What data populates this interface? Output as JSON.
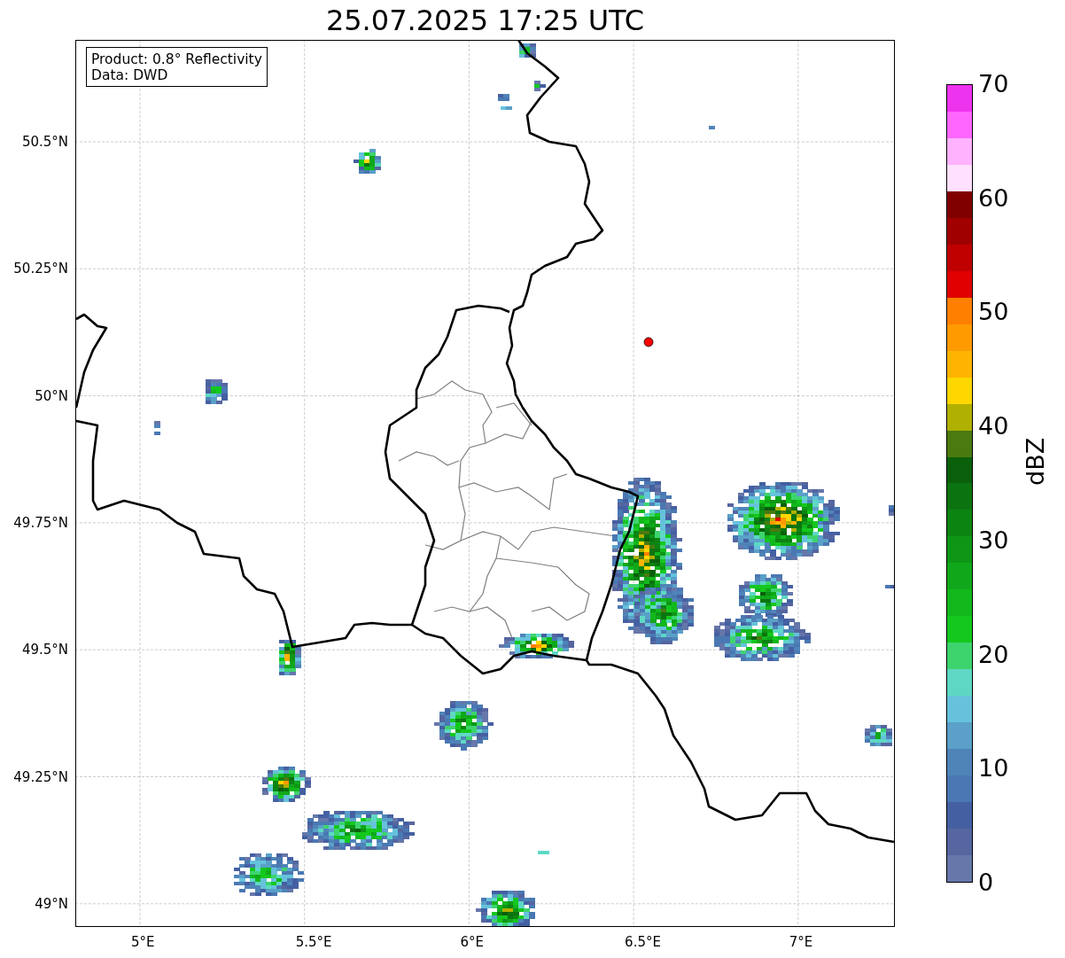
{
  "title": "25.07.2025 17:25 UTC",
  "info_box": {
    "lines": [
      "Product: 0.8° Reflectivity",
      "Data: DWD"
    ]
  },
  "y_ticks": [
    "50.5°N",
    "50.25°N",
    "50°N",
    "49.75°N",
    "49.5°N",
    "49.25°N",
    "49°N"
  ],
  "x_ticks": [
    "5°E",
    "5.5°E",
    "6°E",
    "6.5°E",
    "7°E"
  ],
  "colorbar": {
    "label": "dBZ",
    "ticks": [
      "70",
      "60",
      "50",
      "40",
      "30",
      "20",
      "10",
      "0"
    ],
    "bands": [
      {
        "color": "#6677aa"
      },
      {
        "color": "#5566a0"
      },
      {
        "color": "#4460a2"
      },
      {
        "color": "#4a78b2"
      },
      {
        "color": "#4f84b8"
      },
      {
        "color": "#5aa0c8"
      },
      {
        "color": "#66c2dc"
      },
      {
        "color": "#5ed8c4"
      },
      {
        "color": "#3dd46e"
      },
      {
        "color": "#14c81e"
      },
      {
        "color": "#12b81c"
      },
      {
        "color": "#10a81a"
      },
      {
        "color": "#0e9616"
      },
      {
        "color": "#0c8412"
      },
      {
        "color": "#0b7410"
      },
      {
        "color": "#0a600a"
      },
      {
        "color": "#4a7a10"
      },
      {
        "color": "#b0b000"
      },
      {
        "color": "#ffd700"
      },
      {
        "color": "#ffb400"
      },
      {
        "color": "#ff9a00"
      },
      {
        "color": "#ff7f00"
      },
      {
        "color": "#e00000"
      },
      {
        "color": "#c00000"
      },
      {
        "color": "#a00000"
      },
      {
        "color": "#800000"
      },
      {
        "color": "#ffe0ff"
      },
      {
        "color": "#ffb3ff"
      },
      {
        "color": "#ff66ff"
      },
      {
        "color": "#ee33ee"
      }
    ]
  }
}
